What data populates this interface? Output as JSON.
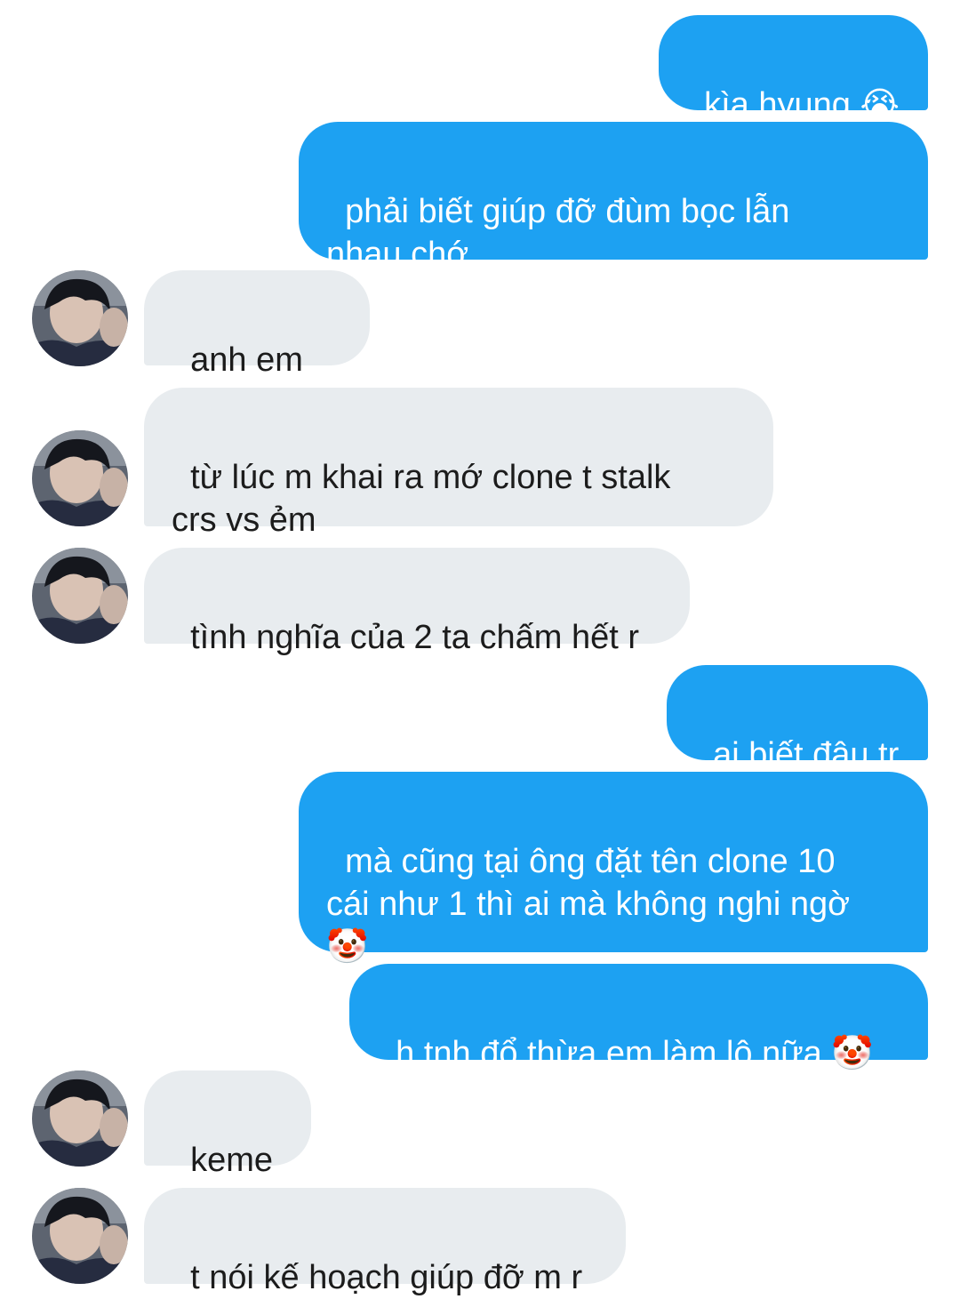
{
  "conversation": {
    "messages": [
      {
        "from": "me",
        "text": "kìa hyung 😭"
      },
      {
        "from": "me",
        "text": "phải biết giúp đỡ đùm bọc lẫn\nnhau chớ"
      },
      {
        "from": "them",
        "text": "anh em cc",
        "avatar_icon": "user-avatar"
      },
      {
        "from": "them",
        "text": "từ lúc m khai ra mớ clone t stalk\ncrs vs ẻm",
        "avatar_icon": "user-avatar"
      },
      {
        "from": "them",
        "text": "tình nghĩa của 2 ta chấm hết r",
        "avatar_icon": "user-avatar"
      },
      {
        "from": "me",
        "text": "ai biết đâu tr"
      },
      {
        "from": "me",
        "text": "mà cũng tại ông đặt tên clone 10\ncái như 1 thì ai mà không nghi ngờ\n🤡"
      },
      {
        "from": "me",
        "text": "h tnh đổ thừa em làm lộ nữa 🤡"
      },
      {
        "from": "them",
        "text": "keme t",
        "avatar_icon": "user-avatar"
      },
      {
        "from": "them",
        "text": "t nói kế hoạch giúp đỡ m r",
        "avatar_icon": "user-avatar"
      }
    ]
  },
  "colors": {
    "sent_bubble": "#1da1f2",
    "received_bubble": "#e8ecef",
    "sent_text": "#ffffff",
    "received_text": "#1c1c1c"
  }
}
